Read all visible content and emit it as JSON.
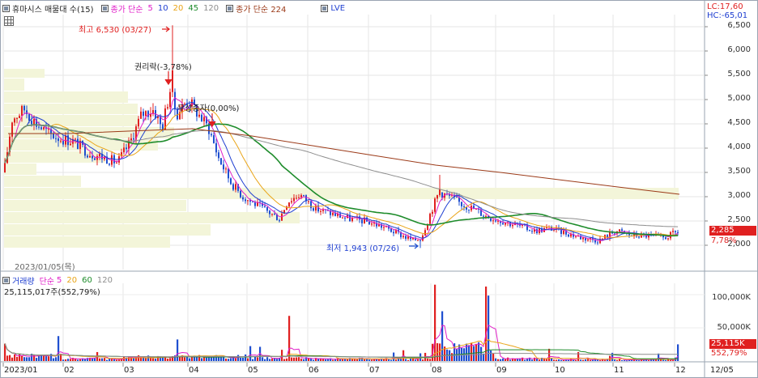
{
  "legend": {
    "title": "휴마시스 매물대 수(15)",
    "ma_label": "종가 단순",
    "ma_periods": [
      "5",
      "10",
      "20",
      "45",
      "120"
    ],
    "ma_colors": [
      "#e01ec8",
      "#1f3fd1",
      "#e9a417",
      "#1e8c2b",
      "#8e8e8e"
    ],
    "ma224_label": "종가 단순 224",
    "ma224_color": "#9b3a18",
    "lve_label": "LVE"
  },
  "annotations": {
    "high": "최고 6,530 (03/27)",
    "rights": "권리락(-3,78%)",
    "dividend": "무상증자(0,00%)",
    "low": "최저 1,943 (07/26)",
    "date_marker": "2023/01/05(목)"
  },
  "right_info": {
    "lc": "LC:17,60",
    "hc": "HC:-65,01",
    "price_badge": "2,285",
    "price_change": "7,78%",
    "vol_badge": "25,115K",
    "vol_change": "552,79%"
  },
  "price_axis": {
    "ticks": [
      "6,500",
      "6,000",
      "5,500",
      "5,000",
      "4,500",
      "4,000",
      "3,500",
      "3,000",
      "2,500",
      "2,000"
    ]
  },
  "volume_panel": {
    "legend_title": "거래량",
    "legend_ma_label": "단순",
    "legend_periods": [
      "5",
      "20",
      "60",
      "120"
    ],
    "legend_colors": [
      "#e01ec8",
      "#e9a417",
      "#1e8c2b",
      "#8e8e8e"
    ],
    "current": "25,115,017주(552,79%)",
    "axis_ticks": [
      "100,000K",
      "50,000K"
    ]
  },
  "time_axis": {
    "labels": [
      "2023/01",
      "02",
      "03",
      "04",
      "05",
      "06",
      "07",
      "08",
      "09",
      "10",
      "11",
      "12",
      "12/05"
    ]
  },
  "colors": {
    "up": "#e02020",
    "down": "#1f4fd0",
    "volume_profile": "#f3f5d9",
    "grid": "#dcdcdc",
    "badge_red": "#e02020"
  },
  "chart_data": [
    {
      "type": "line",
      "title": "휴마시스 매물대 수(15)",
      "x": [
        "2023/01",
        "02",
        "03",
        "04",
        "05",
        "06",
        "07",
        "08",
        "09",
        "10",
        "11",
        "12"
      ],
      "series": [
        {
          "name": "close",
          "values": [
            4500,
            4300,
            4200,
            5200,
            3300,
            2650,
            2300,
            2950,
            2650,
            2350,
            2200,
            2285
          ]
        },
        {
          "name": "224",
          "values": [
            4300,
            4300,
            4350,
            4400,
            4250,
            4050,
            3850,
            3650,
            3500,
            3350,
            3200,
            3050
          ]
        }
      ],
      "ylim": [
        2000,
        6700
      ],
      "annotations": [
        "최고 6,530 (03/27)",
        "최저 1,943 (07/26)",
        "권리락(-3,78%)",
        "무상증자(0,00%)"
      ]
    },
    {
      "type": "bar",
      "title": "거래량",
      "x": [
        "2023/01",
        "02",
        "03",
        "04",
        "05",
        "06",
        "07",
        "08",
        "09",
        "10",
        "11",
        "12"
      ],
      "values": [
        45000,
        20000,
        35000,
        40000,
        25000,
        20000,
        18000,
        115000,
        20000,
        15000,
        12000,
        25115
      ],
      "ylabel": "",
      "ylim": [
        0,
        130000
      ]
    }
  ]
}
